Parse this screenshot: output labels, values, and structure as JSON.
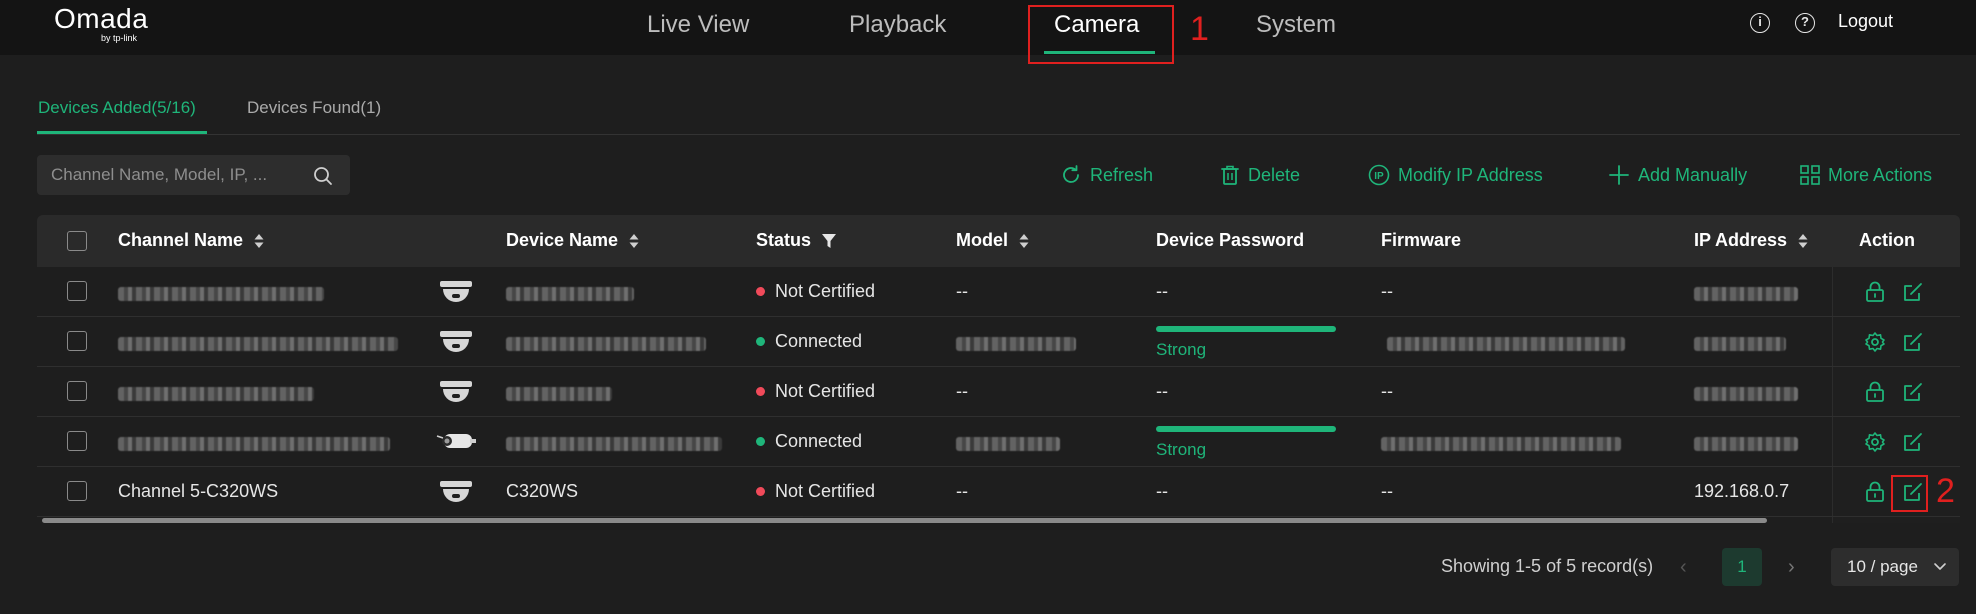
{
  "brand": {
    "name": "Omada",
    "sub": "by tp-link"
  },
  "nav": {
    "live_view": "Live View",
    "playback": "Playback",
    "camera": "Camera",
    "system": "System",
    "active": "Camera"
  },
  "annotations": {
    "one": "1",
    "two": "2"
  },
  "header_right": {
    "info_glyph": "i",
    "help_glyph": "?",
    "logout": "Logout"
  },
  "subtabs": {
    "added": "Devices Added(5/16)",
    "found": "Devices Found(1)"
  },
  "search": {
    "placeholder": "Channel Name, Model, IP, ..."
  },
  "actions": {
    "refresh": "Refresh",
    "delete": "Delete",
    "modify_ip": "Modify IP Address",
    "add_manually": "Add Manually",
    "more": "More Actions"
  },
  "table": {
    "headers": {
      "channel": "Channel Name",
      "device": "Device Name",
      "status": "Status",
      "model": "Model",
      "password": "Device Password",
      "firmware": "Firmware",
      "ip": "IP Address",
      "action": "Action"
    },
    "rows": [
      {
        "channel": "",
        "device": "",
        "status": "Not Certified",
        "status_color": "#f04a5a",
        "model": "--",
        "password": "--",
        "password_strength": "",
        "firmware": "--",
        "ip": "",
        "camera_type": "dome"
      },
      {
        "channel": "",
        "device": "",
        "status": "Connected",
        "status_color": "#1fb57a",
        "model": "",
        "password": "",
        "password_strength": "Strong",
        "firmware": "",
        "ip": "",
        "camera_type": "dome"
      },
      {
        "channel": "",
        "device": "",
        "status": "Not Certified",
        "status_color": "#f04a5a",
        "model": "--",
        "password": "--",
        "password_strength": "",
        "firmware": "--",
        "ip": "",
        "camera_type": "dome"
      },
      {
        "channel": "",
        "device": "",
        "status": "Connected",
        "status_color": "#1fb57a",
        "model": "",
        "password": "",
        "password_strength": "Strong",
        "firmware": "",
        "ip": "",
        "camera_type": "bullet"
      },
      {
        "channel": "Channel 5-C320WS",
        "device": "C320WS",
        "status": "Not Certified",
        "status_color": "#f04a5a",
        "model": "--",
        "password": "--",
        "password_strength": "",
        "firmware": "--",
        "ip": "192.168.0.7",
        "camera_type": "dome"
      }
    ]
  },
  "pagination": {
    "summary": "Showing 1-5 of 5 record(s)",
    "current_page": "1",
    "prev_glyph": "‹",
    "next_glyph": "›",
    "per_page": "10 / page"
  },
  "colors": {
    "accent": "#1fb57a",
    "error": "#f04a5a",
    "annotation": "#e0201f",
    "background": "#1e1e1e"
  }
}
